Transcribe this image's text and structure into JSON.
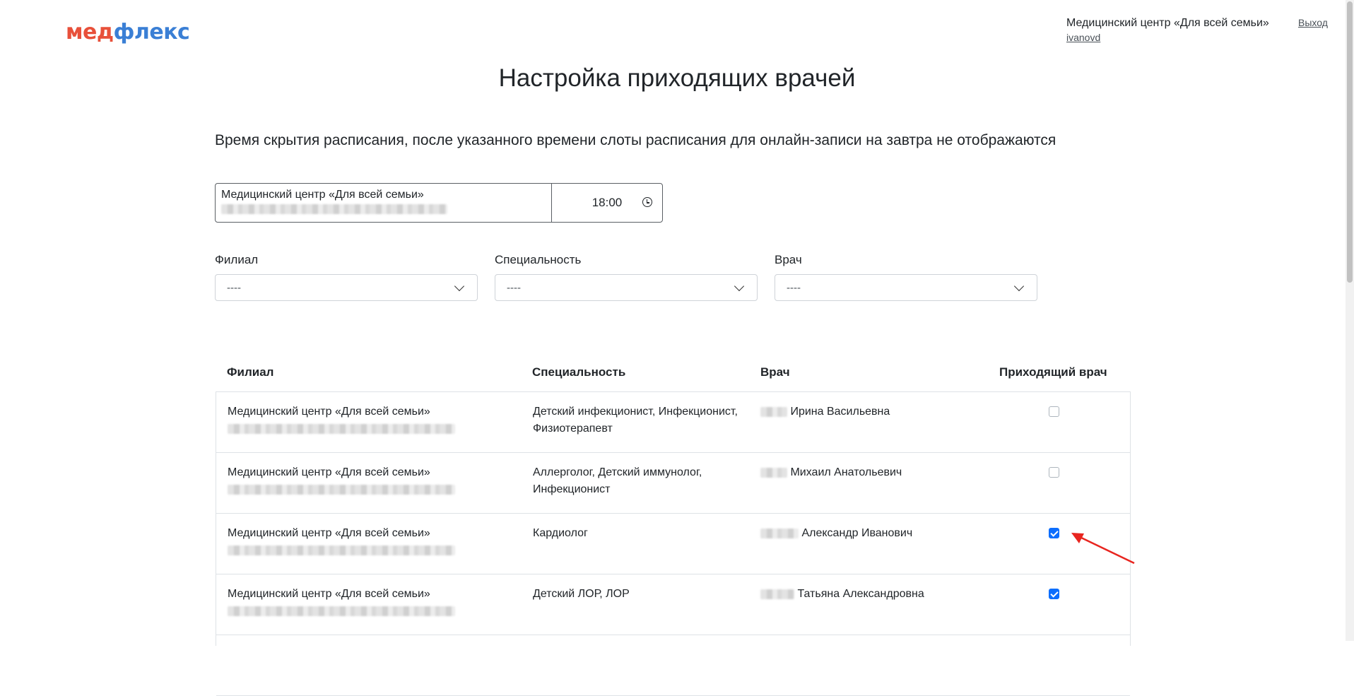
{
  "logo": {
    "part1": "мед",
    "part2": "флекс"
  },
  "header": {
    "center_name": "Медицинский центр «Для всей семьи»",
    "login": "ivanovd",
    "logout": "Выход"
  },
  "page_title": "Настройка приходящих врачей",
  "description": "Время скрытия расписания, после указанного времени слоты расписания для онлайн-записи на завтра не отображаются",
  "time_box": {
    "name": "Медицинский центр «Для всей семьи»",
    "time": "18:00"
  },
  "filters": [
    {
      "label": "Филиал",
      "value": "----"
    },
    {
      "label": "Специальность",
      "value": "----"
    },
    {
      "label": "Врач",
      "value": "----"
    }
  ],
  "table": {
    "columns": [
      "Филиал",
      "Специальность",
      "Врач",
      "Приходящий врач"
    ],
    "rows": [
      {
        "branch": "Медицинский центр «Для всей семьи»",
        "specialty": "Детский инфекционист, Инфекционист, Физиотерапевт",
        "doctor": "Ирина Васильевна",
        "visiting": false
      },
      {
        "branch": "Медицинский центр «Для всей семьи»",
        "specialty": "Аллерголог, Детский иммунолог, Инфекционист",
        "doctor": "Михаил Анатольевич",
        "visiting": false
      },
      {
        "branch": "Медицинский центр «Для всей семьи»",
        "specialty": "Кардиолог",
        "doctor": "Александр Иванович",
        "visiting": true
      },
      {
        "branch": "Медицинский центр «Для всей семьи»",
        "specialty": "Детский ЛОР, ЛОР",
        "doctor": "Татьяна Александровна",
        "visiting": true
      }
    ]
  },
  "colors": {
    "logo_red": "#e8503a",
    "logo_blue": "#3a7fd5",
    "checkbox_checked": "#0d6efd",
    "annotation_arrow": "#e8251f"
  }
}
